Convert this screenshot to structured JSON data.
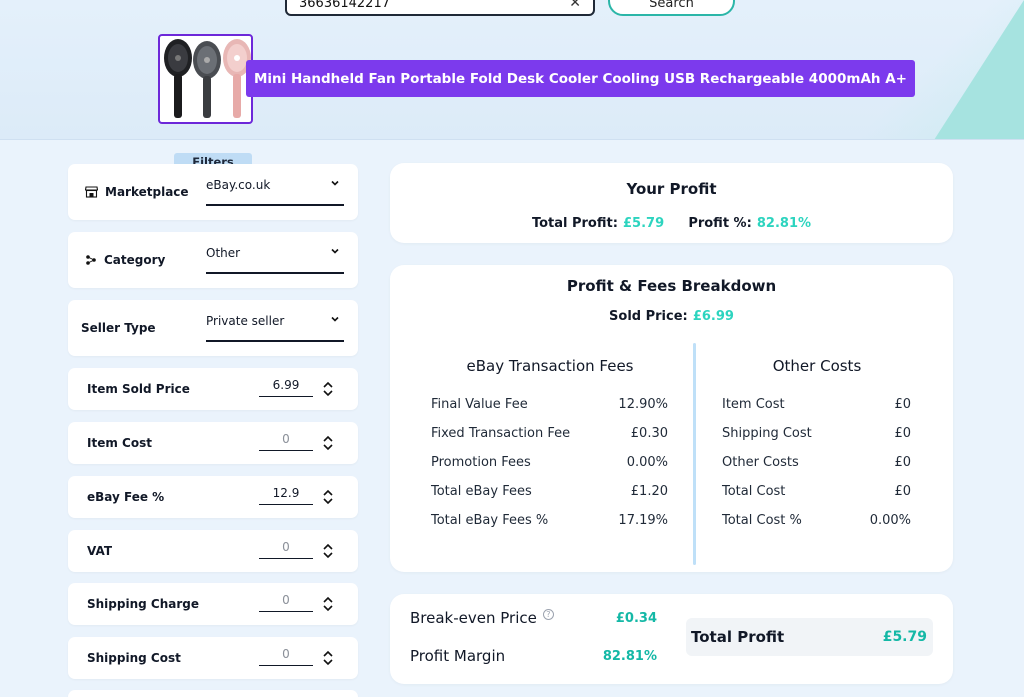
{
  "search": {
    "value": "36636142217",
    "button_label": "Search"
  },
  "product": {
    "title": "Mini Handheld Fan Portable Fold Desk Cooler Cooling USB Rechargeable 4000mAh A+"
  },
  "filters": {
    "tab_label": "Filters",
    "marketplace": {
      "label": "Marketplace",
      "value": "eBay.co.uk"
    },
    "category": {
      "label": "Category",
      "value": "Other"
    },
    "seller_type": {
      "label": "Seller Type",
      "value": "Private seller"
    },
    "item_sold_price": {
      "label": "Item Sold Price",
      "value": "6.99"
    },
    "item_cost": {
      "label": "Item Cost",
      "value": "0"
    },
    "ebay_fee": {
      "label": "eBay Fee %",
      "value": "12.9"
    },
    "vat": {
      "label": "VAT",
      "value": "0"
    },
    "shipping_charge": {
      "label": "Shipping Charge",
      "value": "0"
    },
    "shipping_cost": {
      "label": "Shipping Cost",
      "value": "0"
    }
  },
  "profit": {
    "title": "Your Profit",
    "total_label": "Total Profit:",
    "total_value": "£5.79",
    "pct_label": "Profit %:",
    "pct_value": "82.81%"
  },
  "breakdown": {
    "title": "Profit & Fees Breakdown",
    "sold_label": "Sold Price:",
    "sold_value": "£6.99",
    "fees_title": "eBay Transaction Fees",
    "fees": [
      {
        "label": "Final Value Fee",
        "value": "12.90%"
      },
      {
        "label": "Fixed Transaction Fee",
        "value": "£0.30"
      },
      {
        "label": "Promotion Fees",
        "value": "0.00%"
      },
      {
        "label": "Total eBay Fees",
        "value": "£1.20"
      },
      {
        "label": "Total eBay Fees %",
        "value": "17.19%"
      }
    ],
    "costs_title": "Other Costs",
    "costs": [
      {
        "label": "Item Cost",
        "value": "£0"
      },
      {
        "label": "Shipping Cost",
        "value": "£0"
      },
      {
        "label": "Other Costs",
        "value": "£0"
      },
      {
        "label": "Total Cost",
        "value": "£0"
      },
      {
        "label": "Total Cost %",
        "value": "0.00%"
      }
    ]
  },
  "summary": {
    "breakeven_label": "Break-even Price",
    "breakeven_value": "£0.34",
    "margin_label": "Profit Margin",
    "margin_value": "82.81%",
    "total_label": "Total Profit",
    "total_value": "£5.79",
    "info_glyph": "?"
  },
  "colors": {
    "accent": "#2dd4bf",
    "brand_purple": "#7c3aed",
    "background": "#eaf3fc"
  },
  "icons": {
    "marketplace": "store-icon",
    "category": "category-icon",
    "dropdown": "chevron-down-icon",
    "stepper": "up-down-stepper-icon",
    "search_clear": "close-icon"
  }
}
